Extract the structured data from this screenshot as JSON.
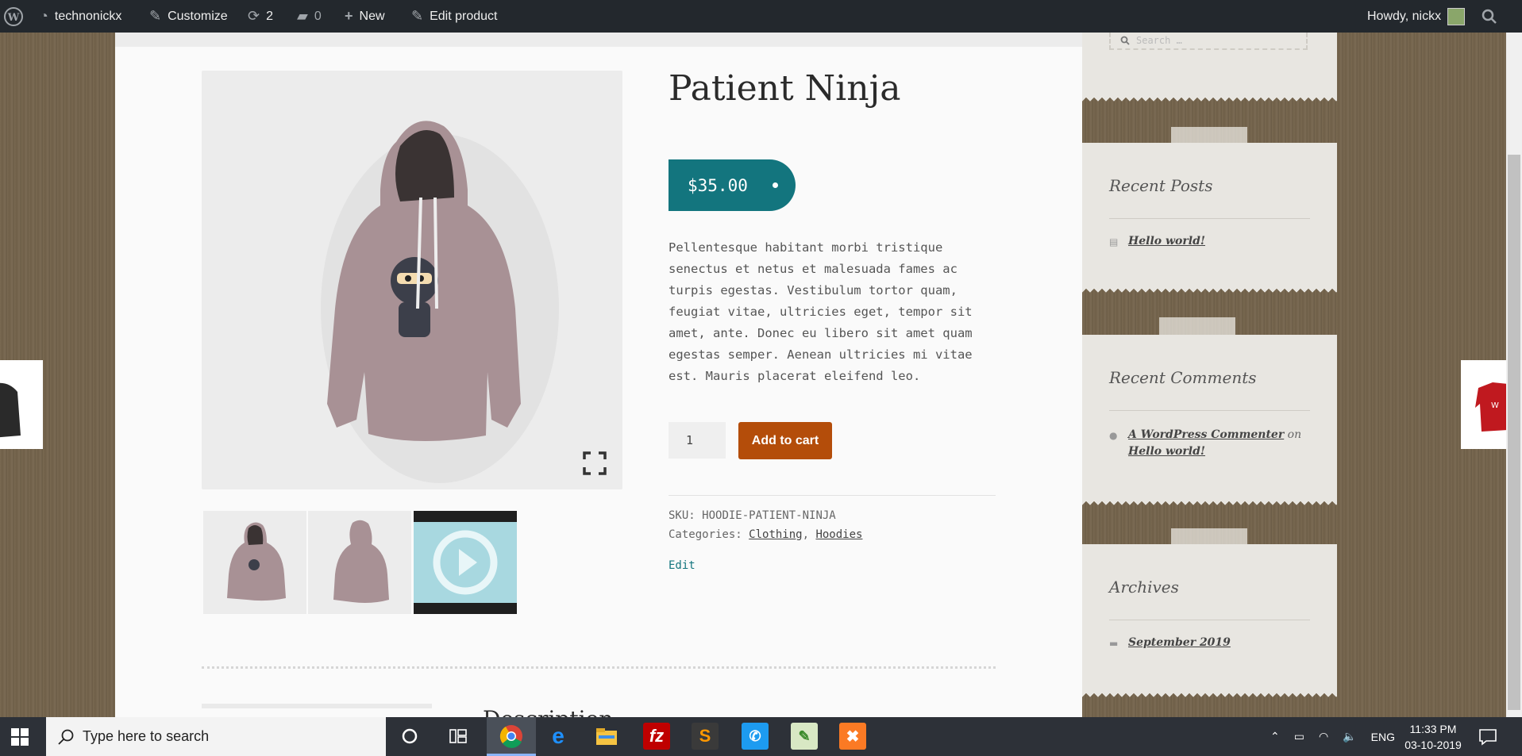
{
  "admin_bar": {
    "site_name": "technonickx",
    "customize": "Customize",
    "updates_count": "2",
    "comments_count": "0",
    "new_label": "New",
    "edit_product": "Edit product",
    "greeting": "Howdy, nickx"
  },
  "sidebar": {
    "search_placeholder": "Search …",
    "recent_posts": {
      "title": "Recent Posts",
      "items": [
        "Hello world!"
      ]
    },
    "recent_comments": {
      "title": "Recent Comments",
      "author": "A WordPress Commenter",
      "on": "on",
      "post": "Hello world!"
    },
    "archives": {
      "title": "Archives",
      "items": [
        "September 2019"
      ]
    }
  },
  "product": {
    "title": "Patient Ninja",
    "price": "$35.00",
    "description": "Pellentesque habitant morbi tristique senectus et netus et malesuada fames ac turpis egestas. Vestibulum tortor quam, feugiat vitae, ultricies eget, tempor sit amet, ante. Donec eu libero sit amet quam egestas semper. Aenean ultricies mi vitae est. Mauris placerat eleifend leo.",
    "quantity": "1",
    "add_to_cart": "Add to cart",
    "sku_label": "SKU:",
    "sku": "HOODIE-PATIENT-NINJA",
    "categories_label": "Categories:",
    "categories": [
      "Clothing",
      "Hoodies"
    ],
    "edit": "Edit",
    "description_tab": "Description"
  },
  "taskbar": {
    "search_placeholder": "Type here to search",
    "language": "ENG",
    "time": "11:33 PM",
    "date": "03-10-2019"
  }
}
